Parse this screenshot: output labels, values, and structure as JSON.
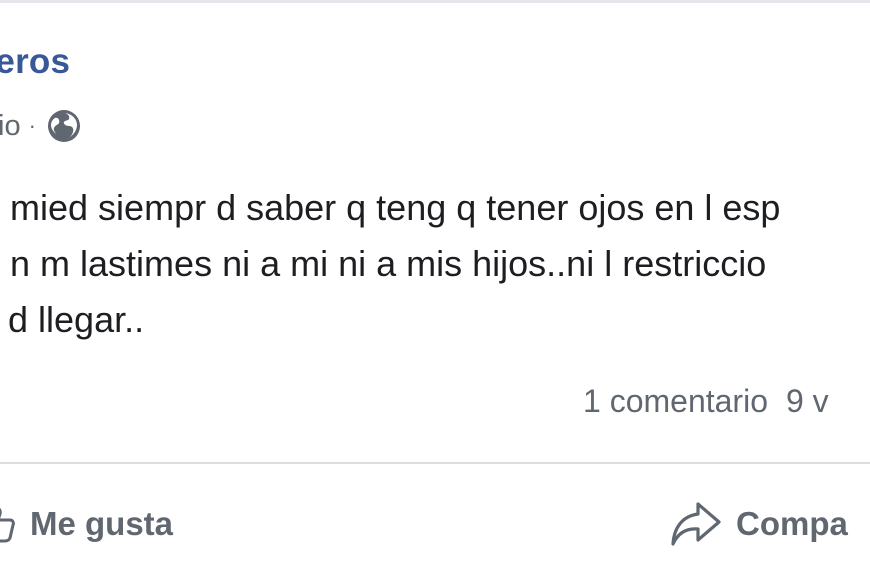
{
  "post": {
    "author_name": "nteros",
    "timestamp": "io",
    "meta_separator": "·",
    "privacy_icon": "globe-icon",
    "lines": [
      "n mied siempr d saber q teng q tener ojos en l esp",
      "q n m lastimes ni a mi ni a mis hijos..ni l restriccio",
      "z d llegar.."
    ]
  },
  "stats": {
    "comments": "1 comentario",
    "views": "9 v"
  },
  "actions": {
    "like_label": "Me gusta",
    "like_icon": "thumbs-up-icon",
    "share_label": "Compa",
    "share_icon": "share-arrow-icon"
  },
  "colors": {
    "author": "#385898",
    "secondary_text": "#606770",
    "body_text": "#1c1e21",
    "divider": "#dadde1"
  }
}
